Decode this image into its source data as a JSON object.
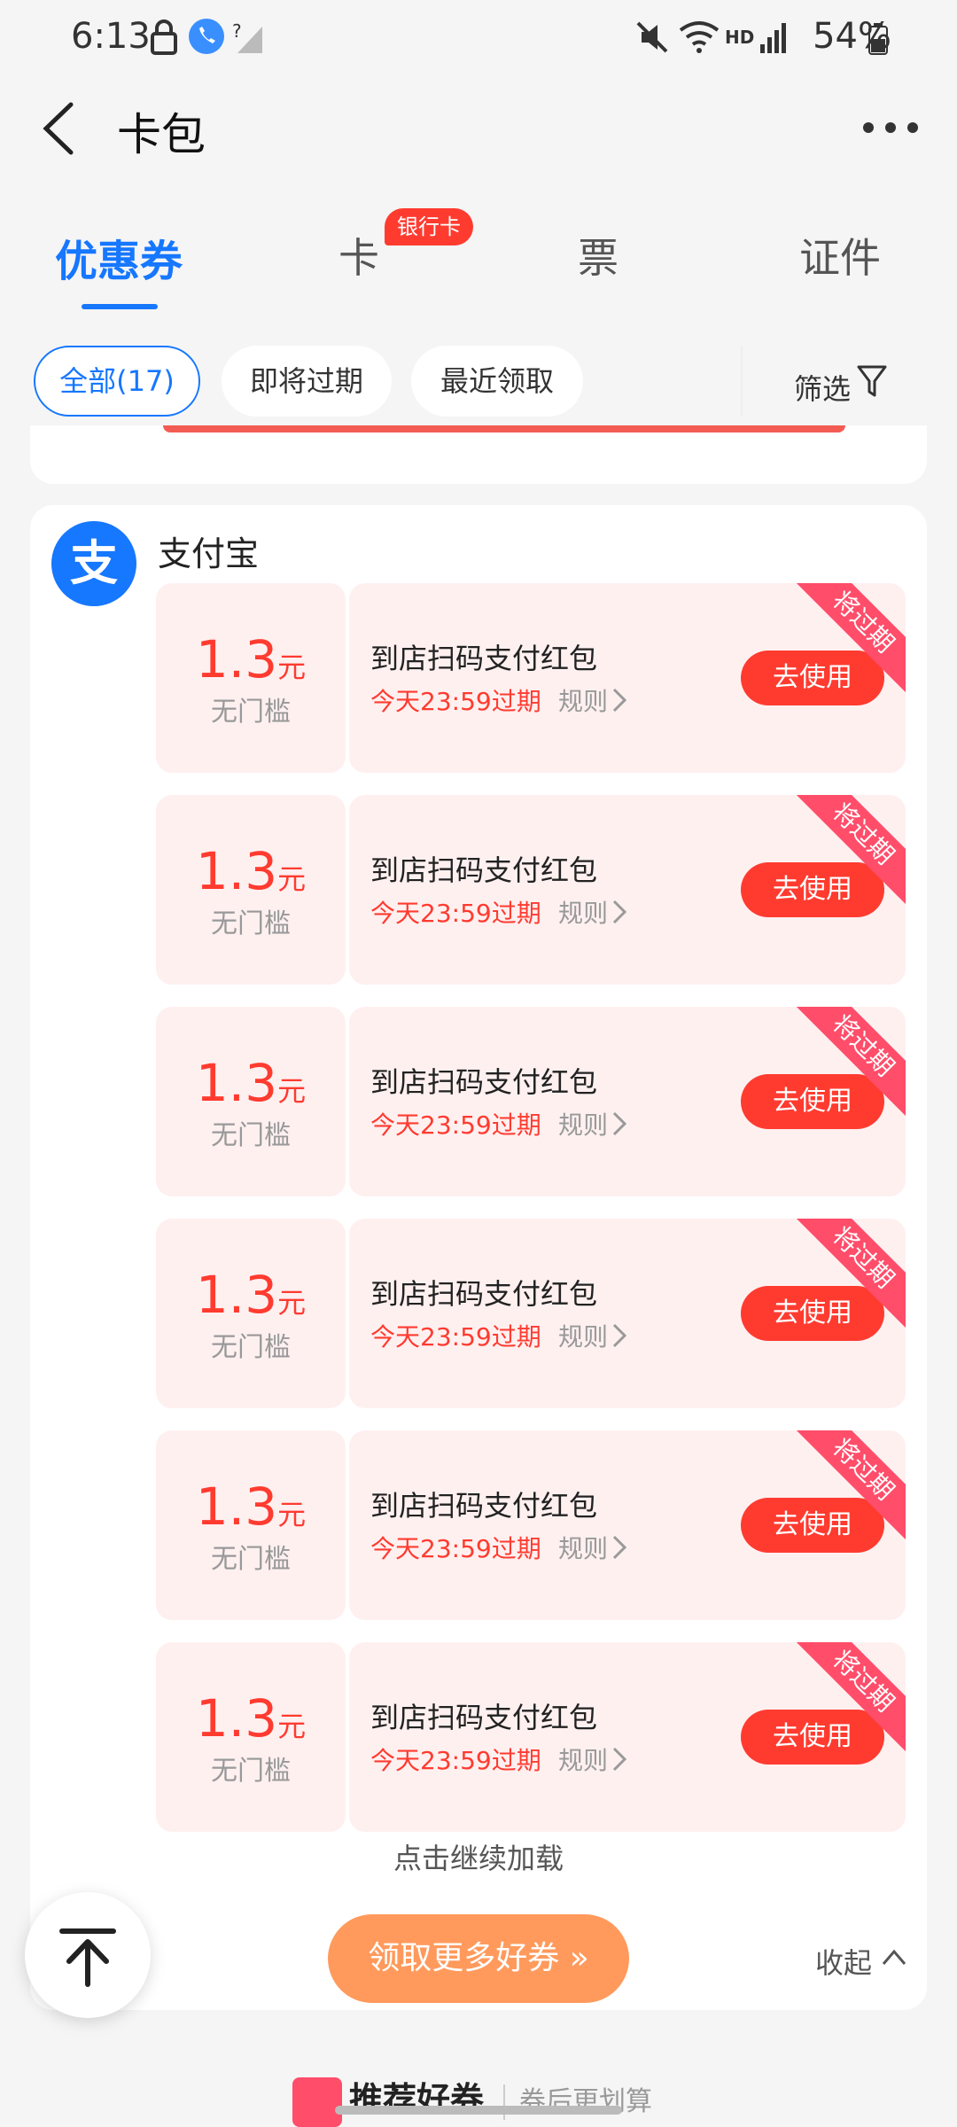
{
  "status_bar": {
    "time": "6:13",
    "battery": "54%",
    "network": "HD"
  },
  "header": {
    "title": "卡包"
  },
  "tabs": [
    {
      "label": "优惠券",
      "active": true
    },
    {
      "label": "卡",
      "badge": "银行卡"
    },
    {
      "label": "票"
    },
    {
      "label": "证件"
    }
  ],
  "filters": {
    "chips": [
      "全部(17)",
      "即将过期",
      "最近领取"
    ],
    "filter_label": "筛选"
  },
  "merchant": {
    "name": "支付宝",
    "logo_glyph": "支"
  },
  "coupons": [
    {
      "amount": "1.3",
      "unit": "元",
      "threshold": "无门槛",
      "title": "到店扫码支付红包",
      "expire": "今天23:59过期",
      "rule": "规则",
      "action": "去使用",
      "ribbon": "将过期"
    },
    {
      "amount": "1.3",
      "unit": "元",
      "threshold": "无门槛",
      "title": "到店扫码支付红包",
      "expire": "今天23:59过期",
      "rule": "规则",
      "action": "去使用",
      "ribbon": "将过期"
    },
    {
      "amount": "1.3",
      "unit": "元",
      "threshold": "无门槛",
      "title": "到店扫码支付红包",
      "expire": "今天23:59过期",
      "rule": "规则",
      "action": "去使用",
      "ribbon": "将过期"
    },
    {
      "amount": "1.3",
      "unit": "元",
      "threshold": "无门槛",
      "title": "到店扫码支付红包",
      "expire": "今天23:59过期",
      "rule": "规则",
      "action": "去使用",
      "ribbon": "将过期"
    },
    {
      "amount": "1.3",
      "unit": "元",
      "threshold": "无门槛",
      "title": "到店扫码支付红包",
      "expire": "今天23:59过期",
      "rule": "规则",
      "action": "去使用",
      "ribbon": "将过期"
    },
    {
      "amount": "1.3",
      "unit": "元",
      "threshold": "无门槛",
      "title": "到店扫码支付红包",
      "expire": "今天23:59过期",
      "rule": "规则",
      "action": "去使用",
      "ribbon": "将过期"
    }
  ],
  "load_more": "点击继续加载",
  "more_coupons_button": "领取更多好券 »",
  "collapse": "收起",
  "bottom_peek": {
    "title": "推荐好券",
    "subtitle": "券后更划算"
  },
  "colors": {
    "accent": "#1677ff",
    "danger": "#ff3b30",
    "orange": "#ff9a5c"
  }
}
